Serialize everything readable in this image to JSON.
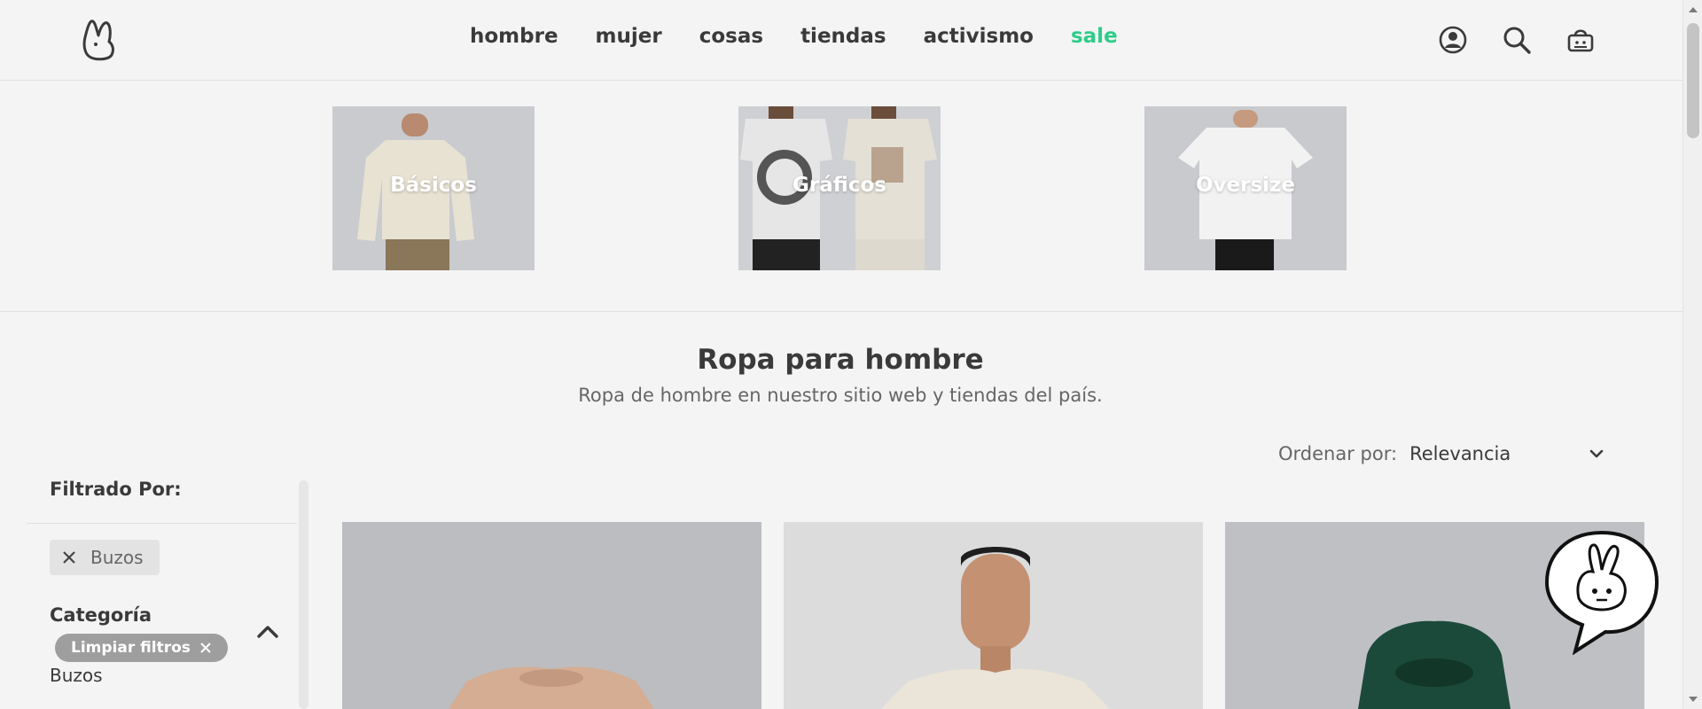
{
  "nav": {
    "items": [
      {
        "label": "hombre"
      },
      {
        "label": "mujer"
      },
      {
        "label": "cosas"
      },
      {
        "label": "tiendas"
      },
      {
        "label": "activismo"
      },
      {
        "label": "sale",
        "color": "#2ecc8a"
      }
    ],
    "icons": [
      "account-icon",
      "search-icon",
      "bag-icon"
    ]
  },
  "categories": [
    {
      "label": "Básicos"
    },
    {
      "label": "Gráficos"
    },
    {
      "label": "Oversize"
    }
  ],
  "page": {
    "title": "Ropa para hombre",
    "subtitle": "Ropa de hombre en nuestro sitio web y tiendas del país."
  },
  "sort": {
    "label": "Ordenar por:",
    "value": "Relevancia"
  },
  "sidebar": {
    "heading": "Filtrado Por:",
    "active_filter": "Buzos",
    "category_heading": "Categoría",
    "clear_label": "Limpiar filtros",
    "category_items": [
      "Buzos"
    ]
  },
  "products": [
    {
      "name": "product-1",
      "color": "#d5ad93"
    },
    {
      "name": "product-2",
      "color": "#ebe4d8"
    },
    {
      "name": "product-3",
      "color": "#1b4a3a"
    }
  ],
  "colors": {
    "accent": "#2ecc8a",
    "text": "#3a3a3a",
    "background": "#f4f4f4"
  }
}
